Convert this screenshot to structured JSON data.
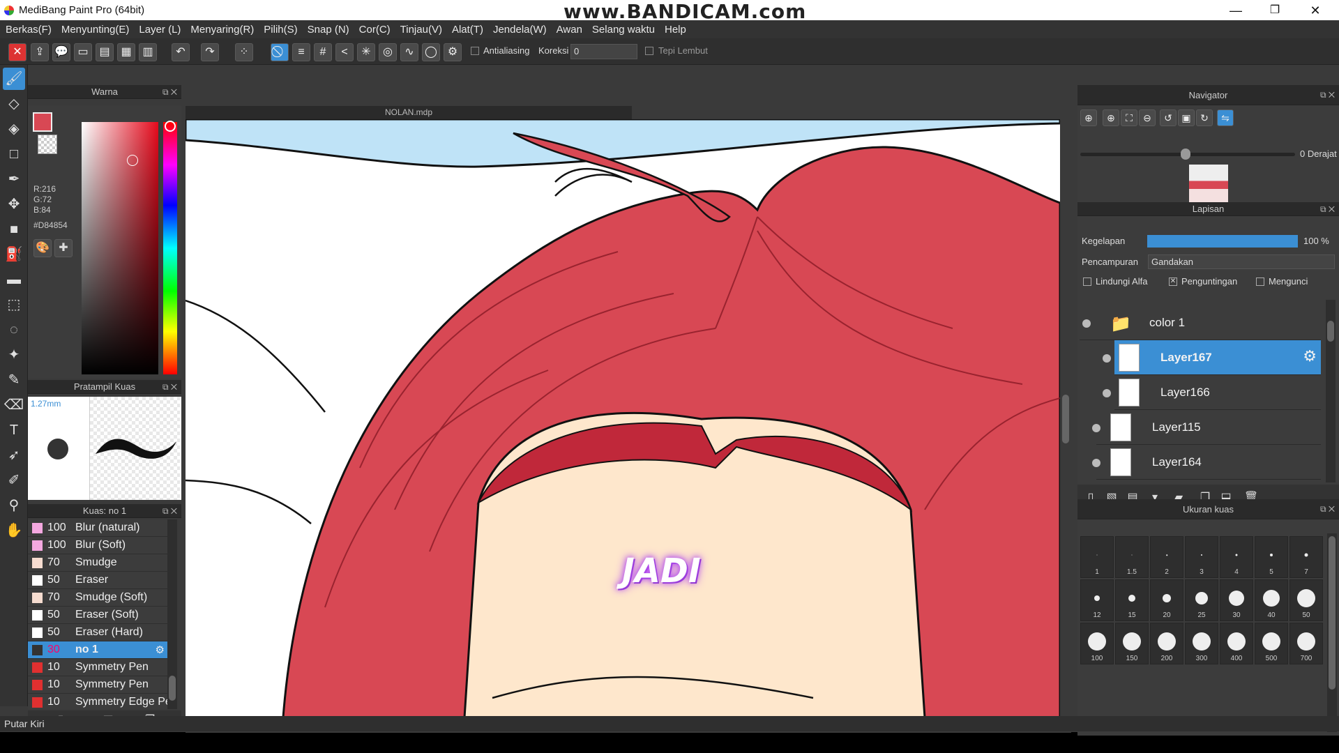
{
  "window": {
    "title": "MediBang Paint Pro (64bit)",
    "watermark": "www.BANDICAM.com",
    "minimize": "—",
    "restore": "❐",
    "close": "✕"
  },
  "menu": [
    "Berkas(F)",
    "Menyunting(E)",
    "Layer (L)",
    "Menyaring(R)",
    "Pilih(S)",
    "Snap (N)",
    "Cor(C)",
    "Tinjau(V)",
    "Alat(T)",
    "Jendela(W)",
    "Awan",
    "Selang waktu",
    "Help"
  ],
  "toolbar": {
    "antialiasing": "Antialiasing",
    "koreksi_label": "Koreksi",
    "koreksi_value": "0",
    "tepi_lembut": "Tepi Lembut"
  },
  "color_panel": {
    "title": "Warna",
    "primary_hex": "#D84854",
    "r": "R:216",
    "g": "G:72",
    "b": "B:84",
    "hex": "#D84854"
  },
  "brush_preview": {
    "title": "Pratampil Kuas",
    "size": "1.27mm"
  },
  "brush_panel": {
    "title": "Kuas: no 1",
    "items": [
      {
        "num": "100",
        "label": "Blur (natural)",
        "color": "#f4a8e0"
      },
      {
        "num": "100",
        "label": "Blur (Soft)",
        "color": "#f4a8e0"
      },
      {
        "num": "70",
        "label": "Smudge",
        "color": "#f6dcd0"
      },
      {
        "num": "50",
        "label": "Eraser",
        "color": "#ffffff"
      },
      {
        "num": "70",
        "label": "Smudge (Soft)",
        "color": "#f6dcd0"
      },
      {
        "num": "50",
        "label": "Eraser (Soft)",
        "color": "#ffffff"
      },
      {
        "num": "50",
        "label": "Eraser (Hard)",
        "color": "#ffffff"
      },
      {
        "num": "30",
        "label": "no 1",
        "color": "#333333",
        "selected": true
      },
      {
        "num": "10",
        "label": "Symmetry Pen",
        "color": "#e03030"
      },
      {
        "num": "10",
        "label": "Symmetry Pen",
        "color": "#e03030"
      },
      {
        "num": "10",
        "label": "Symmetry Edge Pen",
        "color": "#e03030"
      }
    ]
  },
  "document": {
    "tab": "NOLAN.mdp",
    "caption": "JADI"
  },
  "navigator": {
    "title": "Navigator",
    "angle": "0 Derajat"
  },
  "layers": {
    "title": "Lapisan",
    "opacity_label": "Kegelapan",
    "opacity_value": "100 %",
    "opacity_fraction": 1.0,
    "blend_label": "Pencampuran",
    "blend_value": "Gandakan",
    "protect_alpha": "Lindungi Alfa",
    "clipping": "Penguntingan",
    "lock": "Mengunci",
    "folder": "color 1",
    "items": [
      "Layer167",
      "Layer166",
      "Layer115",
      "Layer164"
    ],
    "selected": "Layer167"
  },
  "brush_size": {
    "title": "Ukuran kuas",
    "sizes": [
      "1",
      "1.5",
      "2",
      "3",
      "4",
      "5",
      "7",
      "12",
      "15",
      "20",
      "25",
      "30",
      "40",
      "50",
      "100",
      "150",
      "200",
      "300",
      "400",
      "500",
      "700"
    ]
  },
  "status": "Putar Kiri",
  "colors": {
    "accent": "#3b8fd4",
    "hair": "#D84854",
    "sky": "#bfe3f7",
    "skin": "#fee7cc"
  }
}
